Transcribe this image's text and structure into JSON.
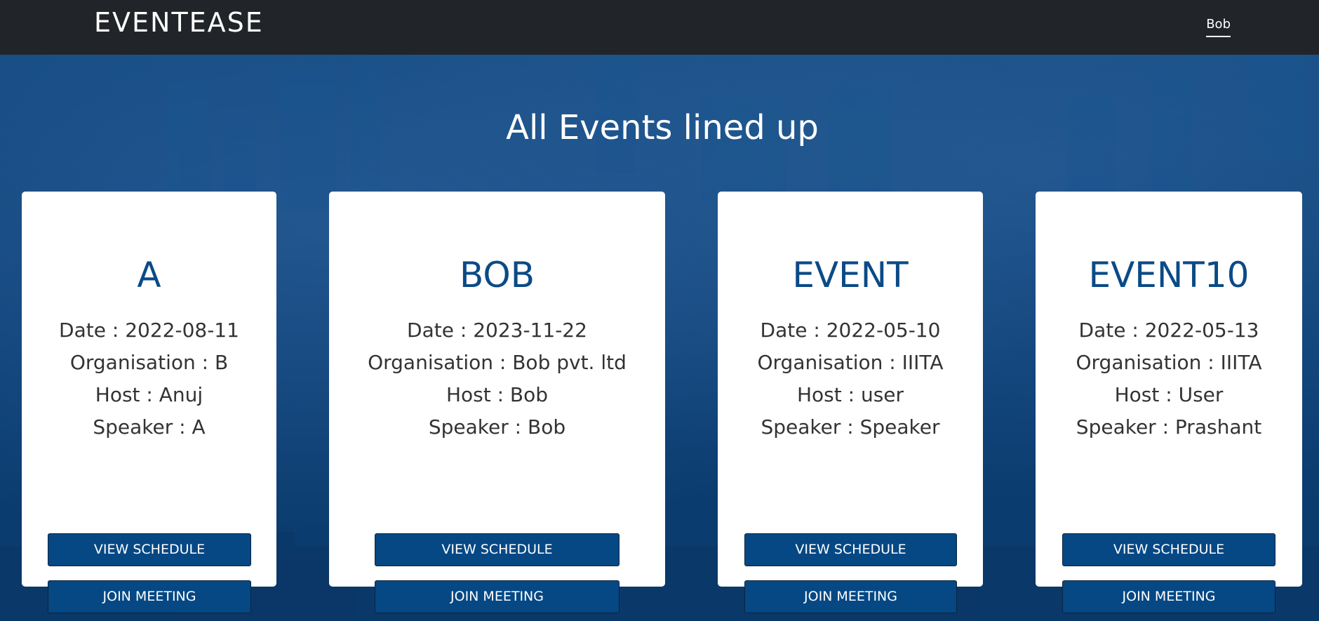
{
  "navbar": {
    "brand": "EVENTEASE",
    "user": "Bob"
  },
  "page_title": "All Events lined up",
  "cards": [
    {
      "title": "A",
      "date": "Date : 2022-08-11",
      "organisation": "Organisation : B",
      "host": "Host : Anuj",
      "speaker": "Speaker : A",
      "view_label": "VIEW SCHEDULE",
      "join_label": "JOIN MEETING"
    },
    {
      "title": "BOB",
      "date": "Date : 2023-11-22",
      "organisation": "Organisation : Bob pvt. ltd",
      "host": "Host : Bob",
      "speaker": "Speaker : Bob",
      "view_label": "VIEW SCHEDULE",
      "join_label": "JOIN MEETING"
    },
    {
      "title": "EVENT",
      "date": "Date : 2022-05-10",
      "organisation": "Organisation : IIITA",
      "host": "Host : user",
      "speaker": "Speaker : Speaker",
      "view_label": "VIEW SCHEDULE",
      "join_label": "JOIN MEETING"
    },
    {
      "title": "EVENT10",
      "date": "Date : 2022-05-13",
      "organisation": "Organisation : IIITA",
      "host": "Host : User",
      "speaker": "Speaker : Prashant",
      "view_label": "VIEW SCHEDULE",
      "join_label": "JOIN MEETING"
    }
  ],
  "colors": {
    "navbar": "#212529",
    "accent": "#054884",
    "title": "#0b4a86",
    "background": "#0b3d6e"
  }
}
